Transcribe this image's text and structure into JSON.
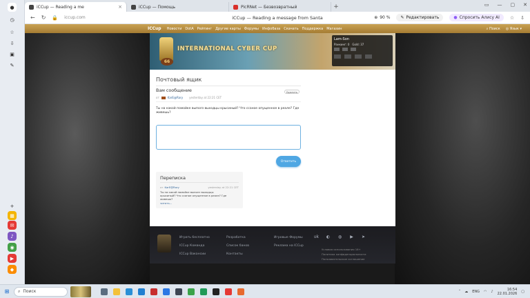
{
  "browser": {
    "tabs": [
      {
        "title": "iCCup — Reading a me",
        "favicon_color": "#444444"
      },
      {
        "title": "iCCup — Помощь",
        "favicon_color": "#444444"
      },
      {
        "title": "PicRNet — Безвозвратный",
        "favicon_color": "#d9312b"
      }
    ],
    "url": "iccup.com",
    "page_title": "iCCup — Reading a message from Santa",
    "zoom": "90 %",
    "edit_button": "Редактировать",
    "alisa_button": "Спросить Алису AI"
  },
  "site": {
    "logo": "ICCup",
    "nav": [
      "Новости",
      "DotA",
      "Рейтинг",
      "Другие карты",
      "Форумы",
      "Инфобаза",
      "Скачать",
      "Поддержка",
      "Магазин"
    ],
    "search": "Поиск",
    "language": "Язык",
    "banner": {
      "title": "INTERNATIONAL CYBER CUP",
      "badge": "66"
    },
    "user": {
      "name": "Lam-Son",
      "rank_label": "Ранкинг: 0",
      "gold": "Gold: 37"
    }
  },
  "mailbox": {
    "heading": "Почтовый ящик",
    "message_title": "Вам сообщение",
    "delete": "Удалить",
    "from_prefix": "от",
    "sender": "KarE@Rary",
    "date": "yesterday at 22:21 CET",
    "body": "Ты на какой помойке выполз выходцы крысиный? Что ссаное опущенное в реале? Где живешь?",
    "reply_button": "Ответить"
  },
  "correspondence": {
    "title": "Переписка",
    "from_prefix": "от",
    "sender": "KarE@Rary",
    "date": "yesterday at 22:21 CET",
    "body": "Ты на какой помойке выполз выходцы крысиный? Что ссаное опущенное в реале? Где живешь?",
    "read_more": "читать..."
  },
  "footer": {
    "col1": [
      "Играть бесплатно",
      "ICCup Команда",
      "ICCup Вакансии"
    ],
    "col2": [
      "Разработка",
      "Список банов",
      "Контакты"
    ],
    "col3": [
      "Игровые Форумы",
      "Реклама на ICCup"
    ],
    "legal": [
      "Условия использования 16+",
      "Политика конфиденциальности",
      "Пользовательское соглашение"
    ]
  },
  "taskbar": {
    "search": "Поиск",
    "lang": "ENG",
    "time": "16:54",
    "date": "22.01.2026"
  }
}
